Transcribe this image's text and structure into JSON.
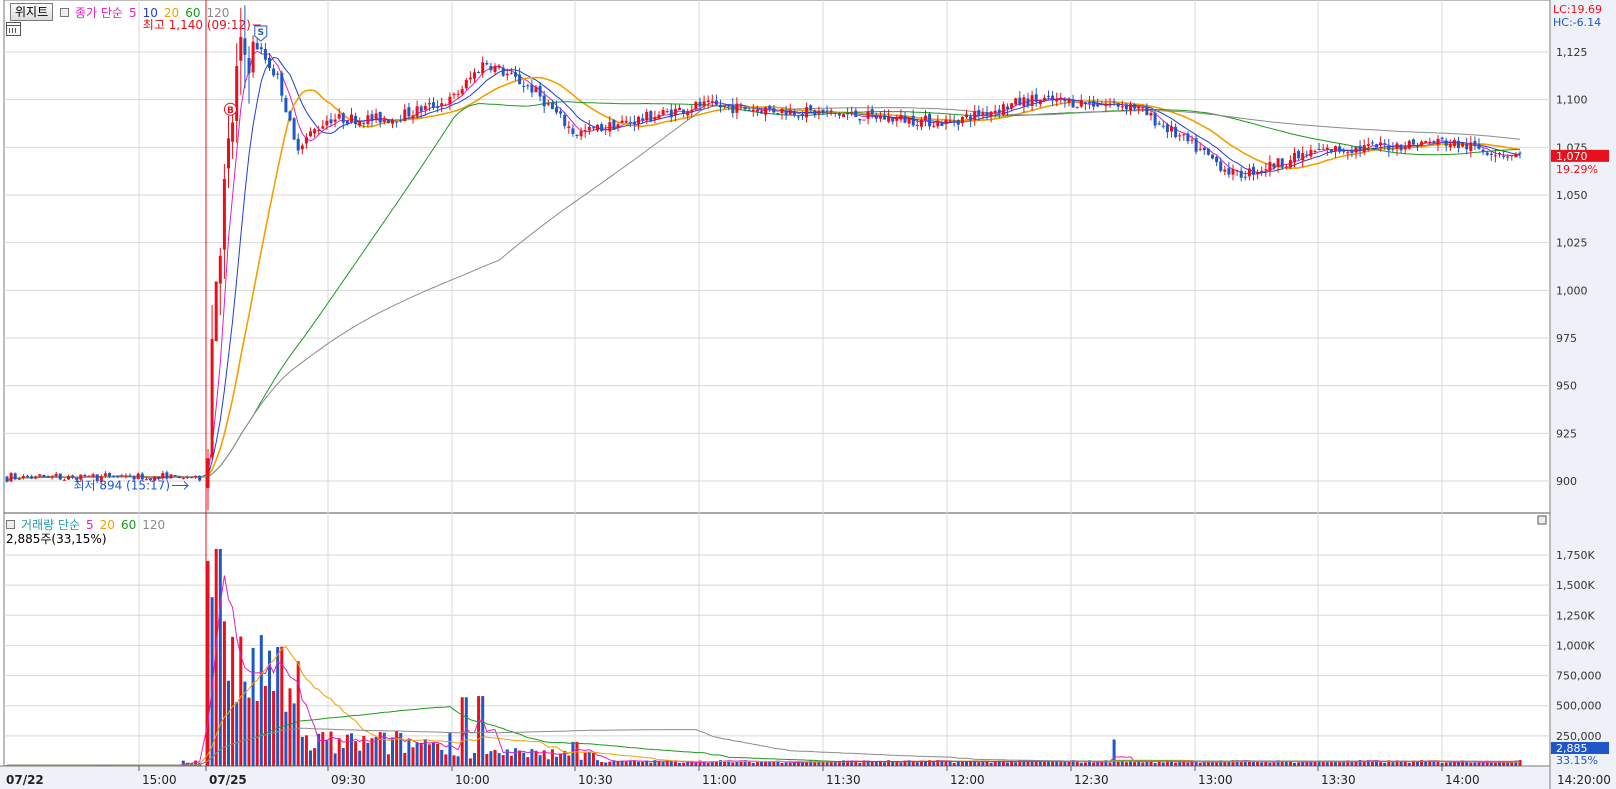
{
  "colors": {
    "up": "#e8101a",
    "down": "#1f57c8",
    "grid": "#d8d8d8",
    "ma5": "#e020c0",
    "ma10": "#1f3fd0",
    "ma20": "#f0a000",
    "ma60": "#1a9a1a",
    "ma120": "#8a8a8a",
    "current_price_bg": "#e8101a",
    "volume_tag_bg": "#1f57c8"
  },
  "toolbar": {
    "widget_button": "위지트",
    "price_legend": {
      "label": "종가 단순",
      "p5": "5",
      "p10": "10",
      "p20": "20",
      "p60": "60",
      "p120": "120"
    },
    "volume_legend": {
      "label": "거래량 단순",
      "p5": "5",
      "p20": "20",
      "p60": "60",
      "p120": "120"
    },
    "volume_info": "2,885주(33,15%)"
  },
  "annotations": {
    "high": "최고 1,140 (09:12)",
    "low": "최저 894 (15:17)",
    "buy_marker": "B",
    "sell_marker": "S"
  },
  "right_panel": {
    "lc": "LC:19.69",
    "hc": "HC:-6.14",
    "current_price": "1,070",
    "current_pct": "19.29%",
    "volume_value": "2,885",
    "volume_pct": "33.15%"
  },
  "price_axis": [
    "1,125",
    "1,100",
    "1,075",
    "1,050",
    "1,025",
    "1,000",
    "975",
    "950",
    "925",
    "900"
  ],
  "volume_axis": [
    "1,750K",
    "1,500K",
    "1,250K",
    "1,000K",
    "750,000",
    "500,000",
    "250,000"
  ],
  "time_axis": [
    "07/22",
    "15:00",
    "07/25",
    "09:30",
    "10:00",
    "10:30",
    "11:00",
    "11:30",
    "12:00",
    "12:30",
    "13:00",
    "13:30",
    "14:00",
    "14:20:00"
  ],
  "chart_data": [
    {
      "type": "candlestick",
      "title": "",
      "ylim": [
        880,
        1140
      ],
      "y_ticks": [
        900,
        925,
        950,
        975,
        1000,
        1025,
        1050,
        1075,
        1100,
        1125
      ],
      "x_categories": [
        "07/22",
        "15:00",
        "07/25",
        "09:30",
        "10:00",
        "10:30",
        "11:00",
        "11:30",
        "12:00",
        "12:30",
        "13:00",
        "13:30",
        "14:00"
      ],
      "high": {
        "value": 1140,
        "time": "09:12"
      },
      "low": {
        "value": 894,
        "time": "15:17"
      },
      "last_close": 1070,
      "key_points": [
        {
          "t": "07/22 14:30",
          "close": 903
        },
        {
          "t": "07/22 15:20",
          "close": 898
        },
        {
          "t": "07/25 09:00",
          "close": 900
        },
        {
          "t": "07/25 09:02",
          "close": 1000
        },
        {
          "t": "07/25 09:05",
          "close": 1060
        },
        {
          "t": "07/25 09:08",
          "close": 1120
        },
        {
          "t": "07/25 09:12",
          "close": 1130
        },
        {
          "t": "07/25 09:18",
          "close": 1110
        },
        {
          "t": "07/25 09:22",
          "close": 1075
        },
        {
          "t": "07/25 09:30",
          "close": 1090
        },
        {
          "t": "07/25 09:45",
          "close": 1090
        },
        {
          "t": "07/25 10:00",
          "close": 1100
        },
        {
          "t": "07/25 10:08",
          "close": 1120
        },
        {
          "t": "07/25 10:20",
          "close": 1105
        },
        {
          "t": "07/25 10:30",
          "close": 1082
        },
        {
          "t": "07/25 11:00",
          "close": 1097
        },
        {
          "t": "07/25 11:30",
          "close": 1093
        },
        {
          "t": "07/25 12:00",
          "close": 1088
        },
        {
          "t": "07/25 12:20",
          "close": 1100
        },
        {
          "t": "07/25 12:45",
          "close": 1097
        },
        {
          "t": "07/25 13:00",
          "close": 1075
        },
        {
          "t": "07/25 13:10",
          "close": 1060
        },
        {
          "t": "07/25 13:30",
          "close": 1073
        },
        {
          "t": "07/25 14:00",
          "close": 1078
        },
        {
          "t": "07/25 14:20",
          "close": 1070
        }
      ],
      "moving_averages": [
        "5",
        "10",
        "20",
        "60",
        "120"
      ]
    },
    {
      "type": "bar",
      "title": "",
      "ylim": [
        0,
        1850000
      ],
      "y_ticks": [
        250000,
        500000,
        750000,
        1000000,
        1250000,
        1500000,
        1750000
      ],
      "key_points": [
        {
          "t": "07/25 09:00",
          "volume": 1700000
        },
        {
          "t": "07/25 09:02",
          "volume": 1400000
        },
        {
          "t": "07/25 09:03",
          "volume": 1800000
        },
        {
          "t": "07/25 09:05",
          "volume": 1200000
        },
        {
          "t": "07/25 09:10",
          "volume": 700000
        },
        {
          "t": "07/25 09:20",
          "volume": 450000
        },
        {
          "t": "07/25 10:03",
          "volume": 570000
        },
        {
          "t": "07/25 10:07",
          "volume": 580000
        },
        {
          "t": "07/25 10:30",
          "volume": 200000
        },
        {
          "t": "07/25 12:40",
          "volume": 220000
        },
        {
          "t": "07/25 14:20",
          "volume": 2885
        }
      ]
    }
  ]
}
